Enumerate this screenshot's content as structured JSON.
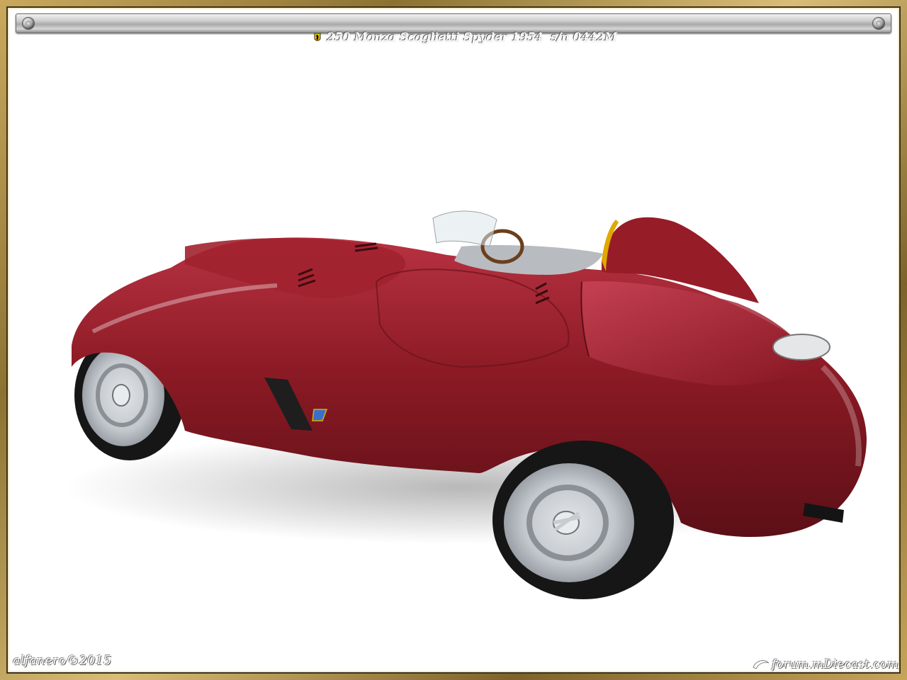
{
  "title_bar": {
    "badge_icon": "prancing-horse-badge-icon",
    "text": "250 Monza Scaglietti Spyder 1954  s/n 0442M"
  },
  "photo": {
    "subject_color": "#8b1a24",
    "background_color": "#ffffff"
  },
  "watermarks": {
    "left": "alfanero©2015",
    "right": "forum.mDiecast.com",
    "right_logo_icon": "forum-swoosh-logo-icon"
  },
  "colors": {
    "frame_gold": "#b8994d",
    "car_red": "#8b1a24",
    "tire_black": "#1a1a1a",
    "wheel_silver": "#c9cdd1"
  }
}
